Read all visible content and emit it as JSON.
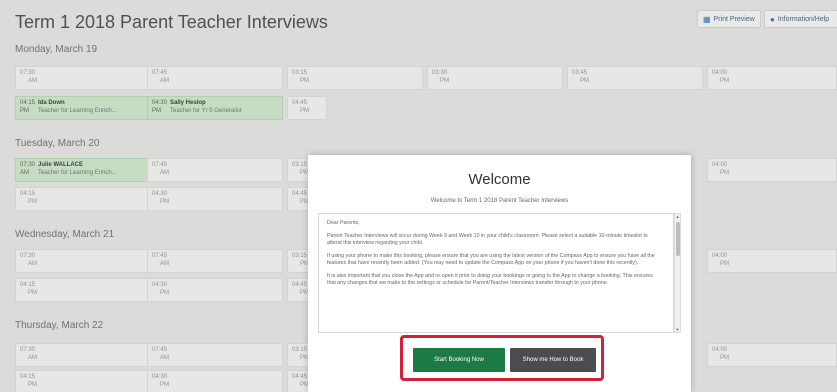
{
  "header": {
    "title": "Term 1 2018 Parent Teacher Interviews",
    "print_preview": "Print Preview",
    "information": "Information/Help"
  },
  "days": [
    {
      "label": "Monday, March 19",
      "row1": [
        "07:30",
        "07:45",
        "03:15",
        "03:30",
        "03:45",
        "04:00"
      ],
      "row1_ampm": [
        "AM",
        "AM",
        "PM",
        "PM",
        "PM",
        "PM"
      ],
      "row2_booked": [
        {
          "time": "04:15",
          "ampm": "PM",
          "name": "Ida Down",
          "role": "Teacher for Learning Enrich..."
        },
        {
          "time": "04:30",
          "ampm": "PM",
          "name": "Sally Heslop",
          "role": "Teacher for Yr 5 Generalist"
        }
      ],
      "row2_free": {
        "time": "04:45",
        "ampm": "PM"
      }
    },
    {
      "label": "Tuesday, March 20",
      "row1_booked": {
        "time": "07:30",
        "ampm": "AM",
        "name": "Julie WALLACE",
        "role": "Teacher for Learning Enrich..."
      },
      "row1": [
        "07:45",
        "03:15",
        "04:00"
      ],
      "row1_ampm": [
        "AM",
        "PM",
        "PM"
      ],
      "row2": [
        "04:15",
        "04:30",
        "04:45"
      ],
      "row2_ampm": [
        "PM",
        "PM",
        "PM"
      ]
    },
    {
      "label": "Wednesday, March 21",
      "row1": [
        "07:30",
        "07:45",
        "03:15",
        "04:00"
      ],
      "row1_ampm": [
        "AM",
        "AM",
        "PM",
        "PM"
      ],
      "row2": [
        "04:15",
        "04:30",
        "04:45"
      ],
      "row2_ampm": [
        "PM",
        "PM",
        "PM"
      ]
    },
    {
      "label": "Thursday, March 22",
      "row1": [
        "07:30",
        "07:45",
        "03:15",
        "04:00"
      ],
      "row1_ampm": [
        "AM",
        "AM",
        "PM",
        "PM"
      ],
      "row2": [
        "04:15",
        "04:30",
        "04:45"
      ],
      "row2_ampm": [
        "PM",
        "PM",
        "PM"
      ]
    }
  ],
  "modal": {
    "title": "Welcome",
    "subtitle": "Welcome to Term 1 2018 Parent Teacher Interviews",
    "greeting": "Dear Parents,",
    "p1": "Parent Teacher Interviews will occur during Week 9 and Week 10 in your child's classroom. Please select a suitable 10-minute timeslot to attend this interview regarding your child.",
    "p2": "If using your phone to make this booking, please ensure that you are using the latest version of the Compass App to ensure you have all the features that have recently been added. (You may need to update the Compass App on your phone if you haven't done this recently).",
    "p3": "It is also important that you close the App and re-open it prior to doing your bookings or going to the App to change a booking. This ensures that any changes that we make to the settings or schedule for Parent/Teacher Interviews transfer through to your phone.",
    "start_button": "Start Booking Now",
    "how_button": "Show me How to Book"
  },
  "colors": {
    "booked": "#cfe7cd",
    "start": "#1c7a45",
    "how": "#4b4c50",
    "highlight": "#d61f3b"
  }
}
